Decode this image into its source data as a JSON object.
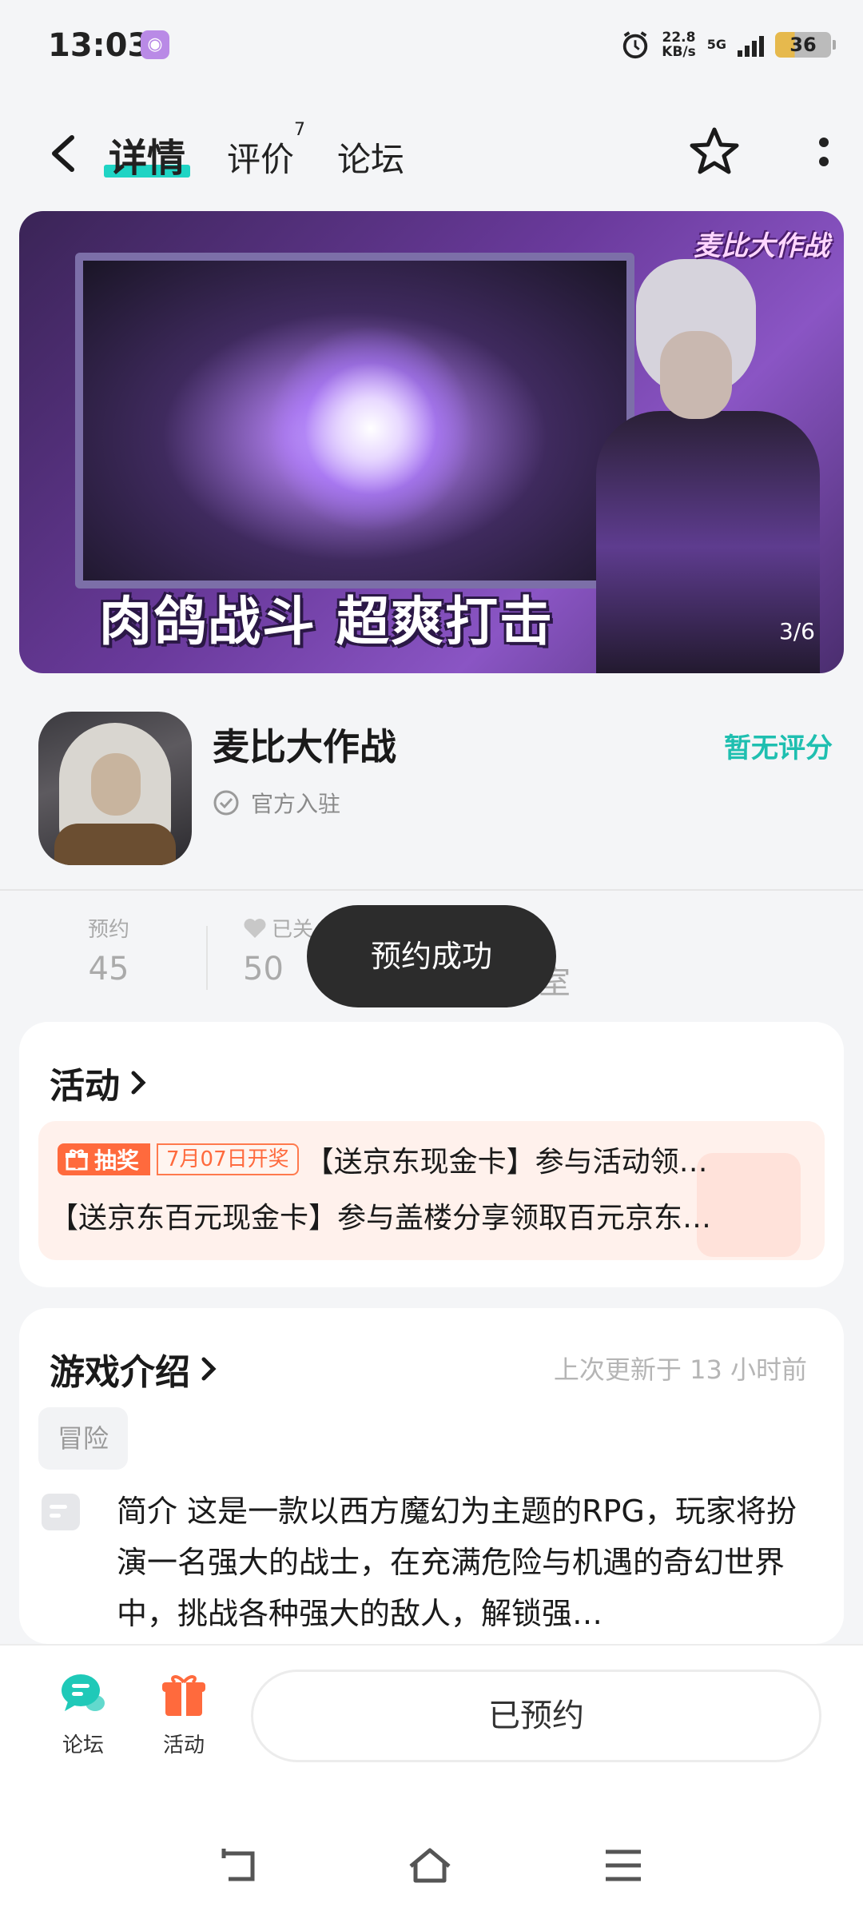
{
  "status_bar": {
    "time": "13:03",
    "net_speed_value": "22.8",
    "net_speed_unit": "KB/s",
    "network": "5G",
    "battery": "36"
  },
  "header": {
    "tabs": [
      {
        "label": "详情",
        "active": true
      },
      {
        "label": "评价",
        "badge": "7"
      },
      {
        "label": "论坛"
      }
    ]
  },
  "banner": {
    "logo_text": "麦比大作战",
    "slogan": "肉鸽战斗 超爽打击",
    "counter": "3/6"
  },
  "app": {
    "name": "麦比大作战",
    "official_label": "官方入驻",
    "rating_text": "暂无评分"
  },
  "stats": {
    "reservations": {
      "label": "预约",
      "value": "45"
    },
    "followed": {
      "label": "已关",
      "value": "50"
    },
    "partial_text": "室"
  },
  "toast": {
    "text": "预约成功"
  },
  "activity": {
    "title": "活动",
    "badge_label": "抽奖",
    "date_label": "7月07日开奖",
    "line1": "【送京东现金卡】参与活动领…",
    "line2": "【送京东百元现金卡】参与盖楼分享领取百元京东…"
  },
  "intro": {
    "title": "游戏介绍",
    "updated": "上次更新于 13 小时前",
    "genre_tag": "冒险",
    "text": "简介 这是一款以西方魔幻为主题的RPG，玩家将扮演一名强大的战士，在充满危险与机遇的奇幻世界中，挑战各种强大的敌人，解锁强…"
  },
  "bottom_bar": {
    "forum_label": "论坛",
    "activity_label": "活动",
    "reserved_button": "已预约"
  },
  "colors": {
    "accent_teal": "#1fd4c4",
    "rating_teal": "#1fbfb0",
    "lottery_orange": "#ff6a3d",
    "toast_bg": "#2c2c2c"
  }
}
